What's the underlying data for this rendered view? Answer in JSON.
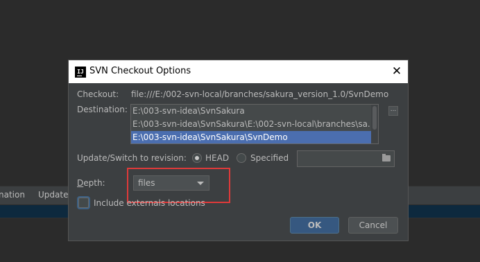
{
  "background": {
    "menu_items": [
      "nation",
      "Update"
    ]
  },
  "dialog": {
    "title": "SVN Checkout Options",
    "app_icon_text": "IJ",
    "checkout_label": "Checkout:",
    "checkout_url": "file:///E:/002-svn-local/branches/sakura_version_1.0/SvnDemo",
    "destination_label": "Destination:",
    "destinations": [
      "E:\\003-svn-idea\\SvnSakura",
      "E:\\003-svn-idea\\SvnSakura\\E:\\002-svn-local\\branches\\sa...",
      "E:\\003-svn-idea\\SvnSakura\\SvnDemo"
    ],
    "selected_destination_index": 2,
    "browse_label": "...",
    "revision_label": "Update/Switch to revision:",
    "revision_options": [
      "HEAD",
      "Specified"
    ],
    "revision_selected": "HEAD",
    "revision_value": "",
    "depth_label_mnemonic": "D",
    "depth_label_rest": "epth:",
    "depth_value": "files",
    "include_externals_label": "Include externals locations",
    "include_externals_checked": false,
    "ok_label": "OK",
    "cancel_label": "Cancel"
  },
  "colors": {
    "dialog_bg": "#3c3f41",
    "selection": "#4b6eaf",
    "highlight_box": "#e03a3a",
    "ok_button": "#365880"
  }
}
